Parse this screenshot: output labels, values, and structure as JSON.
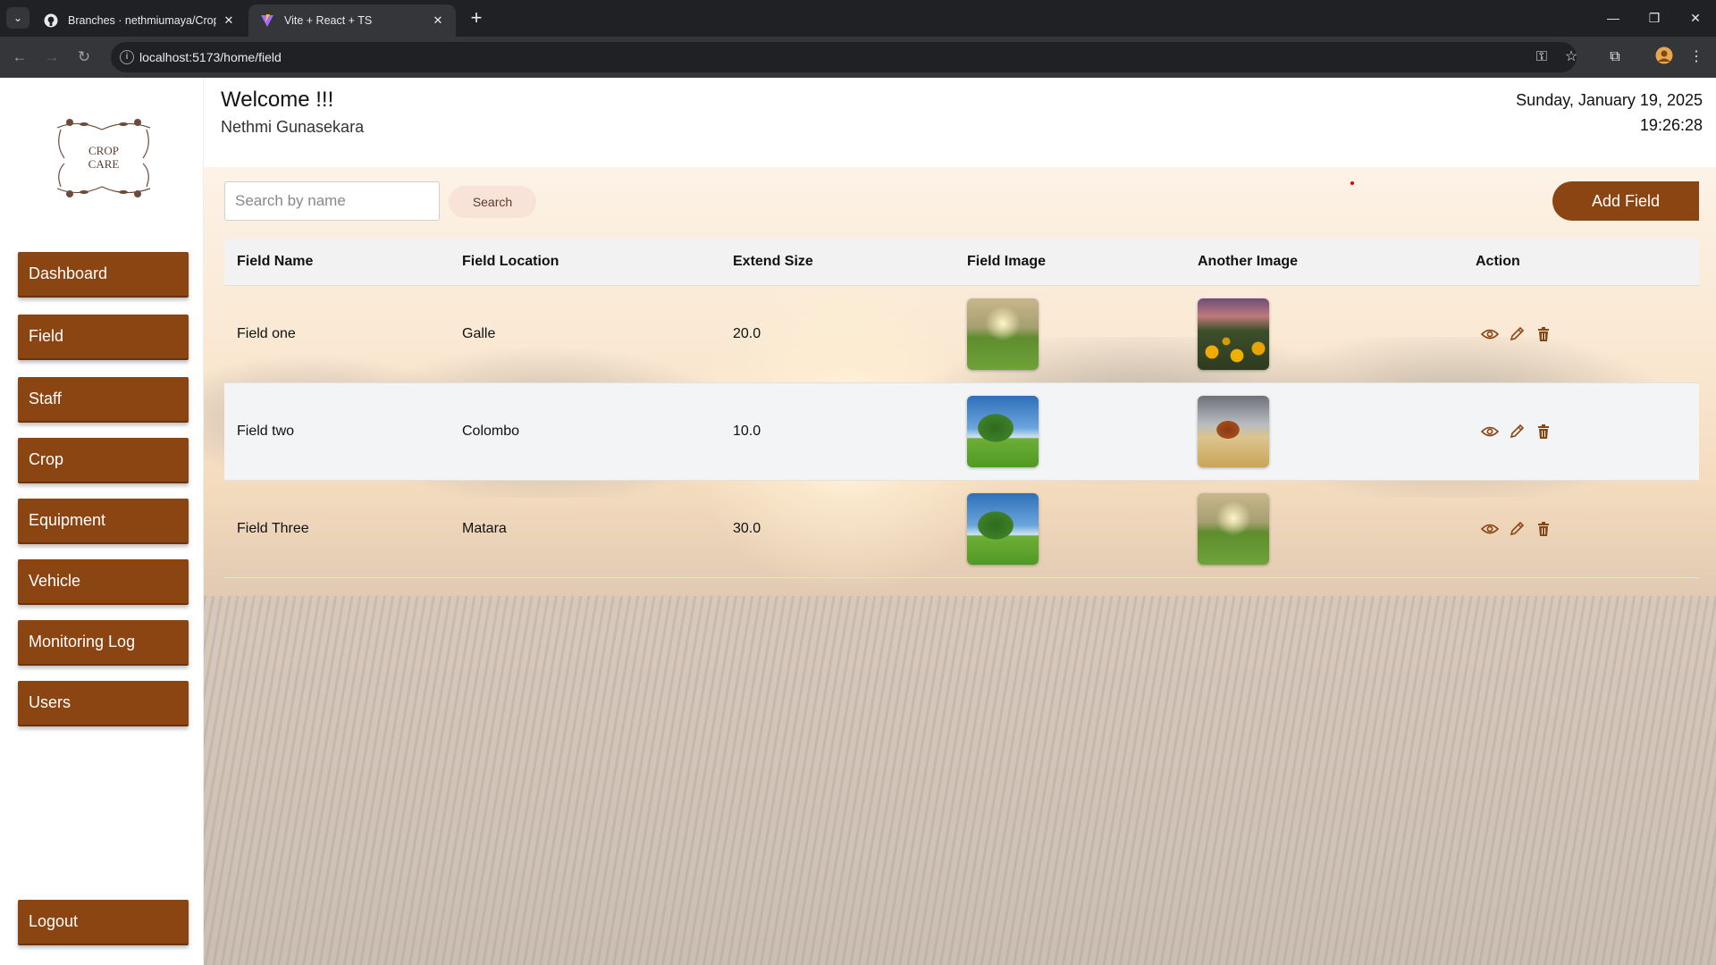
{
  "browser": {
    "tabs": [
      {
        "title": "Branches · nethmiumaya/CropC",
        "active": false
      },
      {
        "title": "Vite + React + TS",
        "active": true
      }
    ],
    "url": "localhost:5173/home/field"
  },
  "header": {
    "welcome": "Welcome !!!",
    "username": "Nethmi Gunasekara",
    "date": "Sunday, January 19, 2025",
    "time": "19:26:28"
  },
  "logo": {
    "line1": "CROP",
    "line2": "CARE"
  },
  "sidebar": {
    "items": [
      {
        "label": "Dashboard"
      },
      {
        "label": "Field"
      },
      {
        "label": "Staff"
      },
      {
        "label": "Crop"
      },
      {
        "label": "Equipment"
      },
      {
        "label": "Vehicle"
      },
      {
        "label": "Monitoring Log"
      },
      {
        "label": "Users"
      }
    ],
    "logout": "Logout"
  },
  "toolbar": {
    "search_placeholder": "Search by name",
    "search_label": "Search",
    "add_label": "Add Field"
  },
  "table": {
    "columns": [
      "Field Name",
      "Field Location",
      "Extend Size",
      "Field Image",
      "Another Image",
      "Action"
    ],
    "rows": [
      {
        "name": "Field one",
        "location": "Galle",
        "size": "20.0",
        "image": "sunset-field",
        "another_image": "sunflowers"
      },
      {
        "name": "Field two",
        "location": "Colombo",
        "size": "10.0",
        "image": "tree-meadow",
        "another_image": "autumn-tree"
      },
      {
        "name": "Field Three",
        "location": "Matara",
        "size": "30.0",
        "image": "tree-meadow",
        "another_image": "sunset-field"
      }
    ]
  },
  "colors": {
    "primary": "#8b4513",
    "search_button_bg": "#f7e3d7"
  }
}
